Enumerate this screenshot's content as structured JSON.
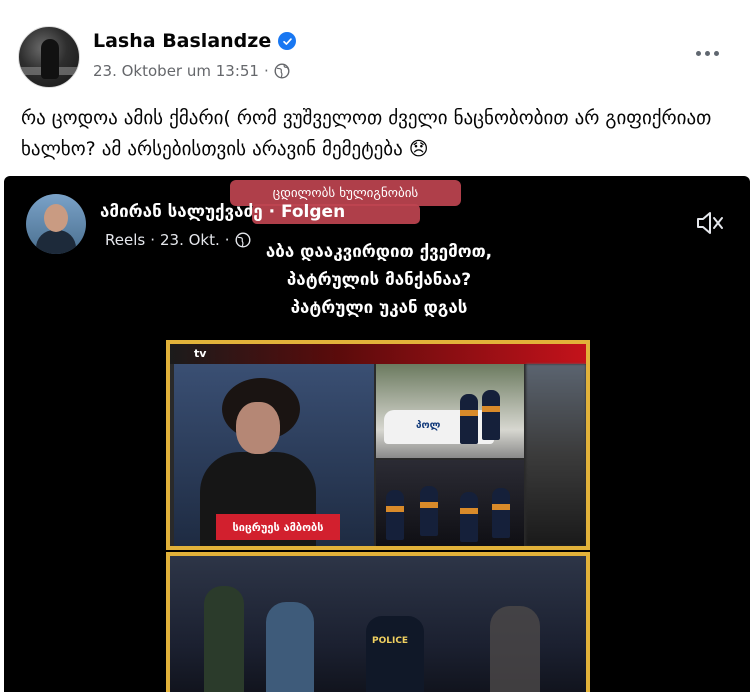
{
  "post": {
    "author": "Lasha Baslandze",
    "timestamp": "23. Oktober um 13:51",
    "separator": "·",
    "text": "რა ცოდოა ამის ქმარი( რომ ვუშველოთ ძველი ნაცნობობით არ გიფიქრიათ ხალხო? ამ არსებისთვის არავინ მემეტება 😞",
    "icons": {
      "verified": "verified-badge-icon",
      "audience": "globe-icon",
      "more": "more-options-icon"
    }
  },
  "reel": {
    "author": "ამირან სალუქვაძე",
    "follow": "· Folgen",
    "type": "Reels",
    "date": "23. Okt.",
    "separator": "·",
    "tag_line": "ცდილობს ხულიგნობის",
    "caption": [
      "აბა დააკვირდით ქვემოთ,",
      "პატრულის მანქანაა?",
      "პატრული უკან დგას"
    ],
    "video": {
      "tv_logo": "tv",
      "lower_third": "სიცრუეს ამბობს",
      "car_label": "პოლ",
      "police_label": "POLICE"
    },
    "icons": {
      "mute": "speaker-muted-icon",
      "audience": "globe-icon"
    }
  },
  "colors": {
    "accent_blue": "#1877f2",
    "frame_gold": "#e2b23a",
    "tag_red": "#be4450"
  }
}
